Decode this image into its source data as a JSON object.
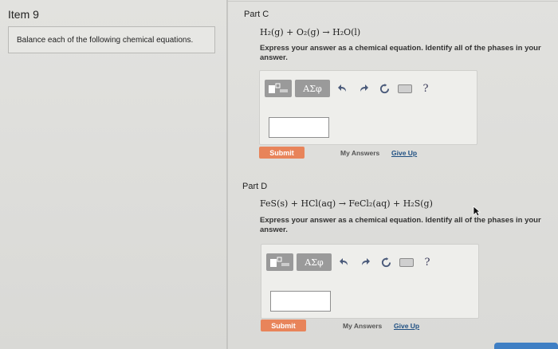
{
  "left_panel": {
    "item_title": "Item 9",
    "instructions": "Balance each of the following chemical equations."
  },
  "part_c": {
    "label": "Part C",
    "equation": "H₂(g) + O₂(g) → H₂O(l)",
    "prompt": "Express your answer as a chemical equation. Identify all of the phases in your answer.",
    "toolbar": {
      "template_icon": "template-icon",
      "greek_label": "ΑΣφ",
      "help_label": "?"
    },
    "input_value": "",
    "submit_label": "Submit",
    "my_answers_label": "My Answers",
    "give_up_label": "Give Up"
  },
  "part_d": {
    "label": "Part D",
    "equation": "FeS(s) + HCl(aq) → FeCl₂(aq) + H₂S(g)",
    "prompt": "Express your answer as a chemical equation. Identify all of the phases in your answer.",
    "toolbar": {
      "template_icon": "template-icon",
      "greek_label": "ΑΣφ",
      "help_label": "?"
    },
    "input_value": "",
    "submit_label": "Submit",
    "my_answers_label": "My Answers",
    "give_up_label": "Give Up"
  },
  "colors": {
    "submit": "#e8845a",
    "give_up_link": "#1e4f82",
    "accent_tab": "#3f7fc4"
  }
}
